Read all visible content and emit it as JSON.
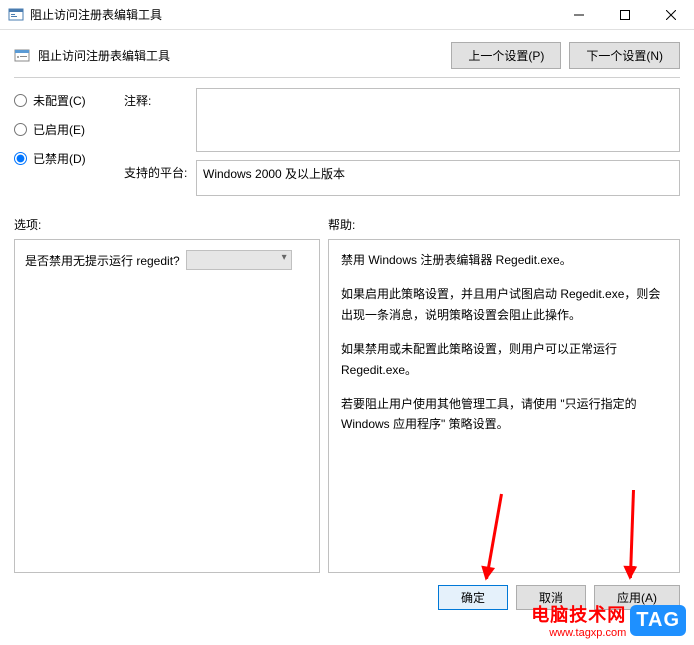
{
  "titlebar": {
    "title": "阻止访问注册表编辑工具"
  },
  "header": {
    "policy_title": "阻止访问注册表编辑工具",
    "prev_btn": "上一个设置(P)",
    "next_btn": "下一个设置(N)"
  },
  "radios": {
    "not_configured": "未配置(C)",
    "enabled": "已启用(E)",
    "disabled": "已禁用(D)"
  },
  "fields": {
    "comment_label": "注释:",
    "comment_value": "",
    "platform_label": "支持的平台:",
    "platform_value": "Windows 2000 及以上版本"
  },
  "sections": {
    "options_label": "选项:",
    "help_label": "帮助:"
  },
  "options": {
    "question": "是否禁用无提示运行 regedit?"
  },
  "help": {
    "p1": "禁用 Windows 注册表编辑器 Regedit.exe。",
    "p2": "如果启用此策略设置，并且用户试图启动 Regedit.exe，则会出现一条消息，说明策略设置会阻止此操作。",
    "p3": "如果禁用或未配置此策略设置，则用户可以正常运行 Regedit.exe。",
    "p4": "若要阻止用户使用其他管理工具，请使用 \"只运行指定的 Windows 应用程序\" 策略设置。"
  },
  "footer": {
    "ok": "确定",
    "cancel": "取消",
    "apply": "应用(A)"
  },
  "watermark": {
    "main": "电脑技术网",
    "sub": "www.tagxp.com",
    "tag": "TAG"
  }
}
